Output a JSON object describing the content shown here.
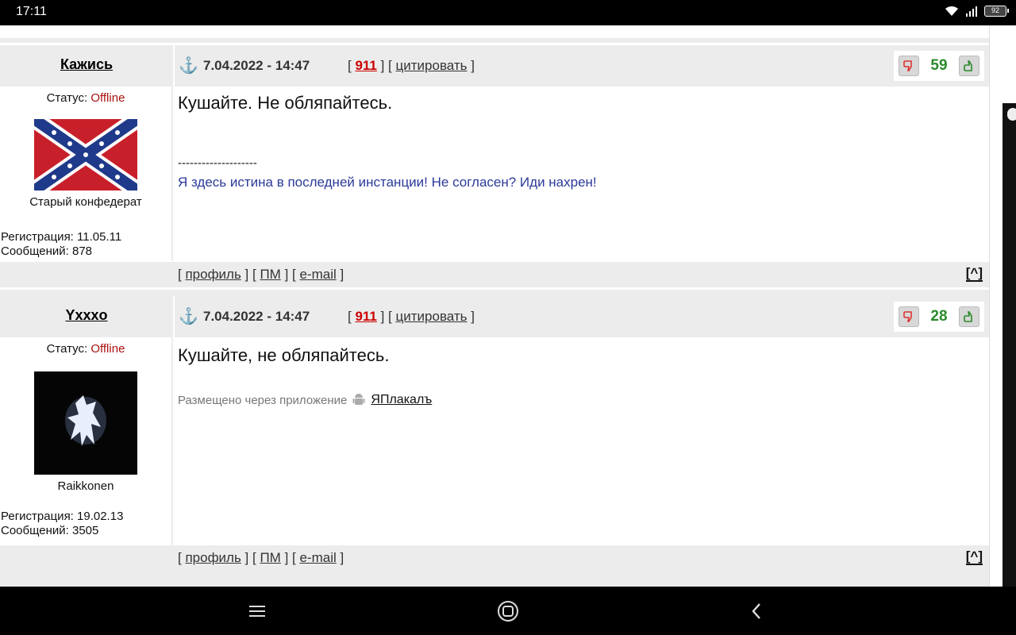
{
  "status_bar": {
    "time": "17:11",
    "battery": "92"
  },
  "posts": [
    {
      "author": "Кажись",
      "date": "7.04.2022 - 14:47",
      "link_911": "911",
      "quote_label": "цитировать",
      "score": "59",
      "status_label": "Статус: ",
      "status_value": "Offline",
      "rank": "Старый конфедерат",
      "registration": "Регистрация: 11.05.11",
      "messages": "Сообщений: 878",
      "message": "Кушайте. Не обляпайтесь.",
      "signature_separator": "--------------------",
      "signature": "Я здесь истина в последней инстанции! Не согласен? Иди нахрен!",
      "footer": {
        "profile": "профиль",
        "pm": "ПМ",
        "email": "e-mail",
        "to_top": "[^]"
      }
    },
    {
      "author": "Yxxxo",
      "date": "7.04.2022 - 14:47",
      "link_911": "911",
      "quote_label": "цитировать",
      "score": "28",
      "status_label": "Статус: ",
      "status_value": "Offline",
      "rank": "Raikkonen",
      "registration": "Регистрация: 19.02.13",
      "messages": "Сообщений: 3505",
      "message": "Кушайте, не обляпайтесь.",
      "via_text": "Размещено через приложение",
      "via_app": "ЯПлакалъ",
      "footer": {
        "profile": "профиль",
        "pm": "ПМ",
        "email": "e-mail",
        "to_top": "[^]"
      }
    }
  ],
  "colors": {
    "header_bg": "#ececec",
    "offline": "#aa1111",
    "score": "#2a8a2a",
    "link_911": "#cc0000",
    "signature": "#2b3a9a"
  }
}
